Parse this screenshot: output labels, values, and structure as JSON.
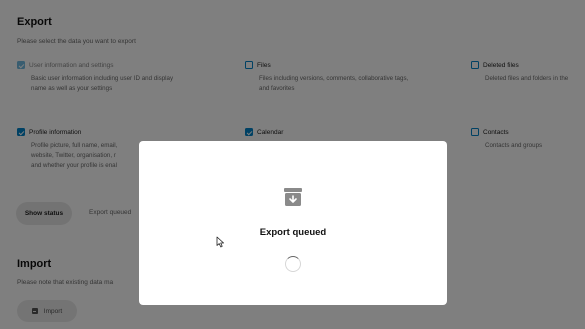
{
  "export": {
    "title": "Export",
    "subtitle": "Please select the data you want to export",
    "options": [
      {
        "label": "User information and settings",
        "checked": true,
        "disabled": true,
        "description": [
          "Basic user information including user ID and display",
          "name as well as your settings"
        ]
      },
      {
        "label": "Files",
        "checked": false,
        "disabled": false,
        "description": [
          "Files including versions, comments, collaborative tags,",
          "and favorites"
        ]
      },
      {
        "label": "Deleted files",
        "checked": false,
        "disabled": false,
        "description": [
          "Deleted files and folders in the"
        ]
      },
      {
        "label": "Profile information",
        "checked": true,
        "disabled": false,
        "description": [
          "Profile picture, full name, email,",
          "website, Twitter, organisation, r",
          "and whether your profile is enal"
        ]
      },
      {
        "label": "Calendar",
        "checked": true,
        "disabled": false,
        "description": []
      },
      {
        "label": "Contacts",
        "checked": false,
        "disabled": false,
        "description": [
          "Contacts and groups"
        ]
      }
    ],
    "show_status_label": "Show status",
    "status_text": "Export queued"
  },
  "import": {
    "title": "Import",
    "subtitle": "Please note that existing data ma",
    "button_label": "Import"
  },
  "modal": {
    "title": "Export queued",
    "icon": "archive-download-icon",
    "loading_icon": "loading-spinner-icon"
  },
  "colors": {
    "accent": "#0082c9",
    "overlay": "rgba(0,0,0,0.5)",
    "icon_grey": "#8a8a8a"
  }
}
